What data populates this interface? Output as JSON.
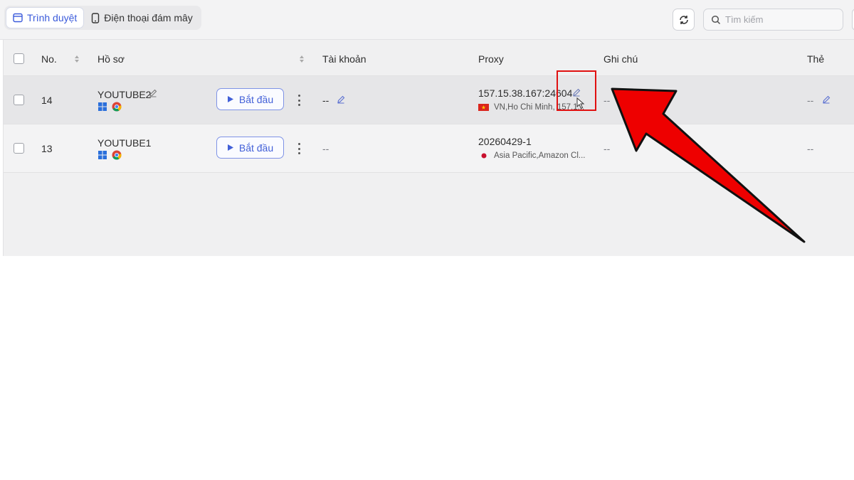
{
  "tabs": [
    {
      "label": "Trình duyệt",
      "active": true
    },
    {
      "label": "Điện thoại đám mây",
      "active": false
    }
  ],
  "search": {
    "placeholder": "Tìm kiếm"
  },
  "table": {
    "headers": {
      "no": "No.",
      "profile": "Hồ sơ",
      "account": "Tài khoản",
      "proxy": "Proxy",
      "note": "Ghi chú",
      "tag": "Thẻ"
    },
    "rows": [
      {
        "no": "14",
        "name": "YOUTUBE2",
        "start_label": "Bắt đầu",
        "account": "--",
        "proxy": "157.15.38.167:24604",
        "proxy_location": "VN,Ho Chi Minh, 157.1...",
        "note": "--",
        "tag": "--"
      },
      {
        "no": "13",
        "name": "YOUTUBE1",
        "start_label": "Bắt đầu",
        "account": "--",
        "proxy": "20260429-1",
        "proxy_location": "Asia Pacific,Amazon Cl...",
        "note": "--",
        "tag": "--"
      }
    ]
  },
  "colors": {
    "accent": "#4260d8",
    "annotation": "#e01010"
  }
}
